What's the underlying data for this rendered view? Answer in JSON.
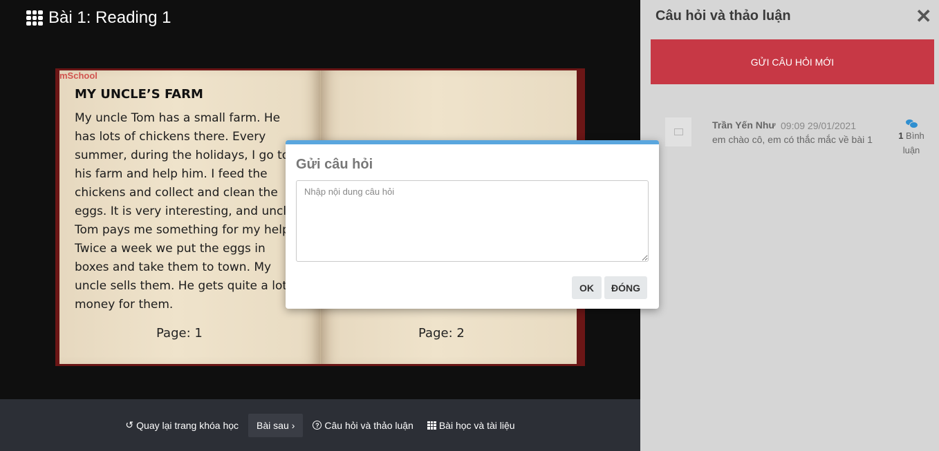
{
  "lesson": {
    "title": "Bài 1: Reading 1"
  },
  "book": {
    "logo": "mSchool",
    "story_title": "MY UNCLE’S FARM",
    "story_text": "My uncle Tom has a small farm. He has lots of chickens there. Every summer, during the holidays, I go to his farm and help him. I feed the chickens and collect and clean the eggs. It is very interesting, and uncle Tom pays me something for my help. Twice a week we put the eggs in boxes and take them to town. My uncle sells them. He gets quite a lot of money for them.",
    "page_left": "Page: 1",
    "page_right": "Page: 2"
  },
  "bottom_bar": {
    "back": "Quay lại trang khóa học",
    "next": "Bài sau",
    "questions": "Câu hỏi và thảo luận",
    "materials": "Bài học và tài liệu"
  },
  "panel": {
    "title": "Câu hỏi và thảo luận",
    "new_question": "GỬI CÂU HỎI MỚI",
    "questions": [
      {
        "author": "Trần Yến Như",
        "time": "09:09 29/01/2021",
        "text": "em chào cô, em có thắc mắc về bài 1",
        "comment_count": "1",
        "comment_label": "Bình luận"
      }
    ]
  },
  "modal": {
    "title": "Gửi câu hỏi",
    "placeholder": "Nhập nội dung câu hỏi",
    "ok": "OK",
    "close": "ĐÓNG"
  },
  "colors": {
    "accent_red": "#c73845",
    "modal_top": "#5aa6de",
    "comment_blue": "#2f8fd0"
  }
}
